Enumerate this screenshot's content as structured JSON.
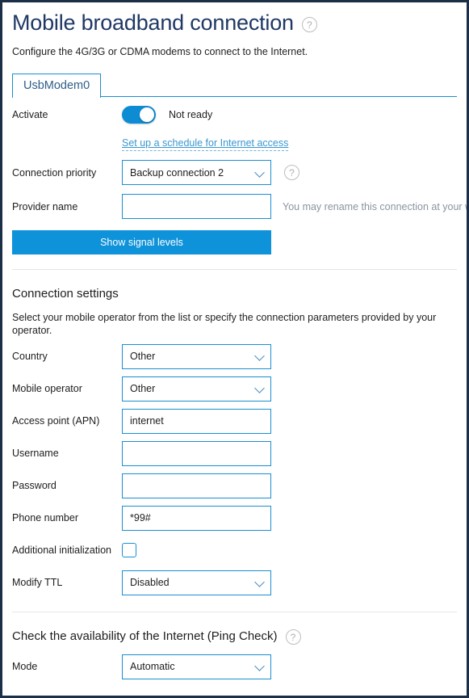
{
  "page": {
    "title": "Mobile broadband connection",
    "help_icon": "question-mark-circle-icon",
    "subtitle": "Configure the 4G/3G or CDMA modems to connect to the Internet."
  },
  "tabs": [
    {
      "label": "UsbModem0",
      "active": true
    }
  ],
  "activation": {
    "activate_label": "Activate",
    "toggle_state": "on",
    "status_text": "Not ready",
    "schedule_link": "Set up a schedule for Internet access",
    "priority_label": "Connection priority",
    "priority_value": "Backup connection 2",
    "priority_help_icon": "question-mark-circle-icon",
    "provider_label": "Provider name",
    "provider_value": "",
    "provider_hint": "You may rename this connection at your will.",
    "signal_button": "Show signal levels"
  },
  "connection_settings": {
    "heading": "Connection settings",
    "description": "Select your mobile operator from the list or specify the connection parameters provided by your operator.",
    "fields": [
      {
        "label": "Country",
        "type": "select",
        "value": "Other"
      },
      {
        "label": "Mobile operator",
        "type": "select",
        "value": "Other"
      },
      {
        "label": "Access point (APN)",
        "type": "text",
        "value": "internet"
      },
      {
        "label": "Username",
        "type": "text",
        "value": ""
      },
      {
        "label": "Password",
        "type": "password",
        "value": ""
      },
      {
        "label": "Phone number",
        "type": "text",
        "value": "*99#"
      },
      {
        "label": "Additional initialization",
        "type": "checkbox",
        "checked": false
      },
      {
        "label": "Modify TTL",
        "type": "select",
        "value": "Disabled"
      }
    ]
  },
  "ping_check": {
    "heading": "Check the availability of the Internet (Ping Check)",
    "help_icon": "question-mark-circle-icon",
    "mode_label": "Mode",
    "mode_value": "Automatic"
  },
  "colors": {
    "accent": "#0e92d9",
    "border_blue": "#1a8fd1",
    "title_navy": "#1f3864",
    "frame": "#1b3047",
    "hint_gray": "#8b949e"
  }
}
